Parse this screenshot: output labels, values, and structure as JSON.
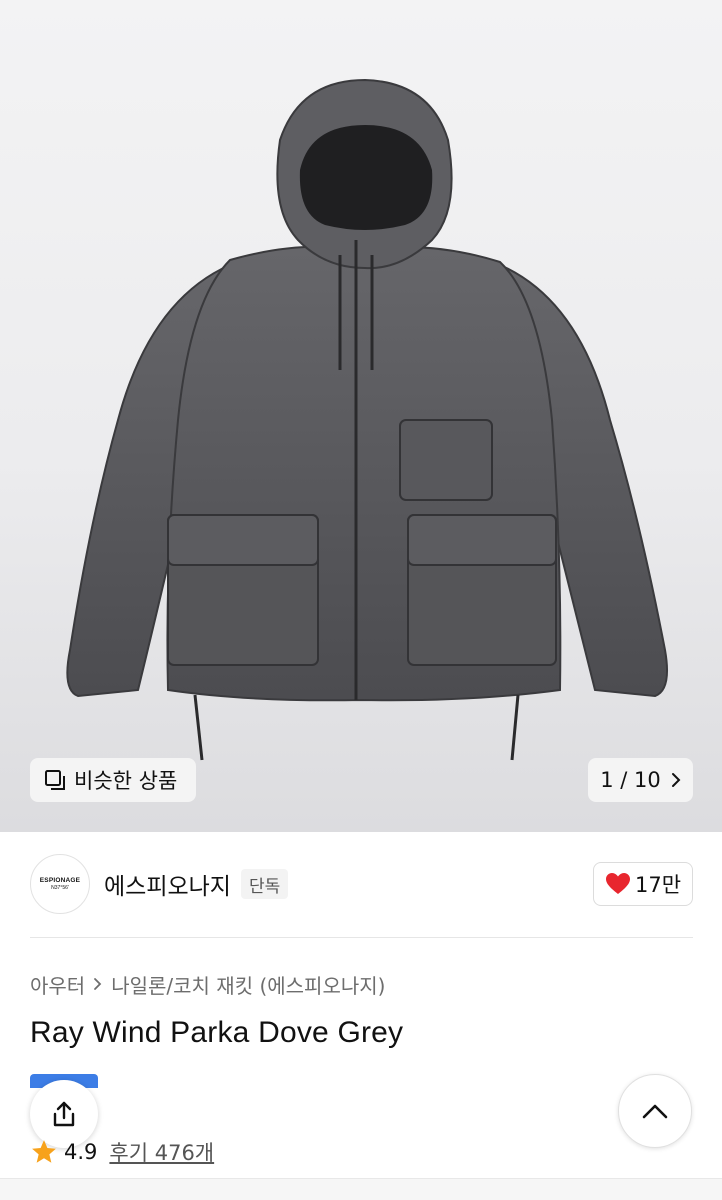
{
  "gallery": {
    "similar_label": "비슷한 상품",
    "pager": "1 / 10"
  },
  "seller": {
    "logo_line1": "ESPIONAGE",
    "logo_line2": "N37°56'",
    "name": "에스피오나지",
    "badge": "단독",
    "likes": "17만"
  },
  "product": {
    "breadcrumb": [
      "아우터",
      "나일론/코치 재킷 (에스피오나지)"
    ],
    "title": "Ray Wind Parka Dove Grey",
    "rating": "4.9",
    "reviews": "후기 476개"
  },
  "colors": {
    "heart": "#e8262e",
    "star": "#f7a21b",
    "accent_blue": "#3c7de6"
  },
  "icons": {
    "similar": "stacked-squares-icon",
    "next": "chevron-right-icon",
    "like": "heart-icon",
    "share": "share-icon",
    "star": "star-icon",
    "scroll_top": "chevron-up-icon"
  }
}
